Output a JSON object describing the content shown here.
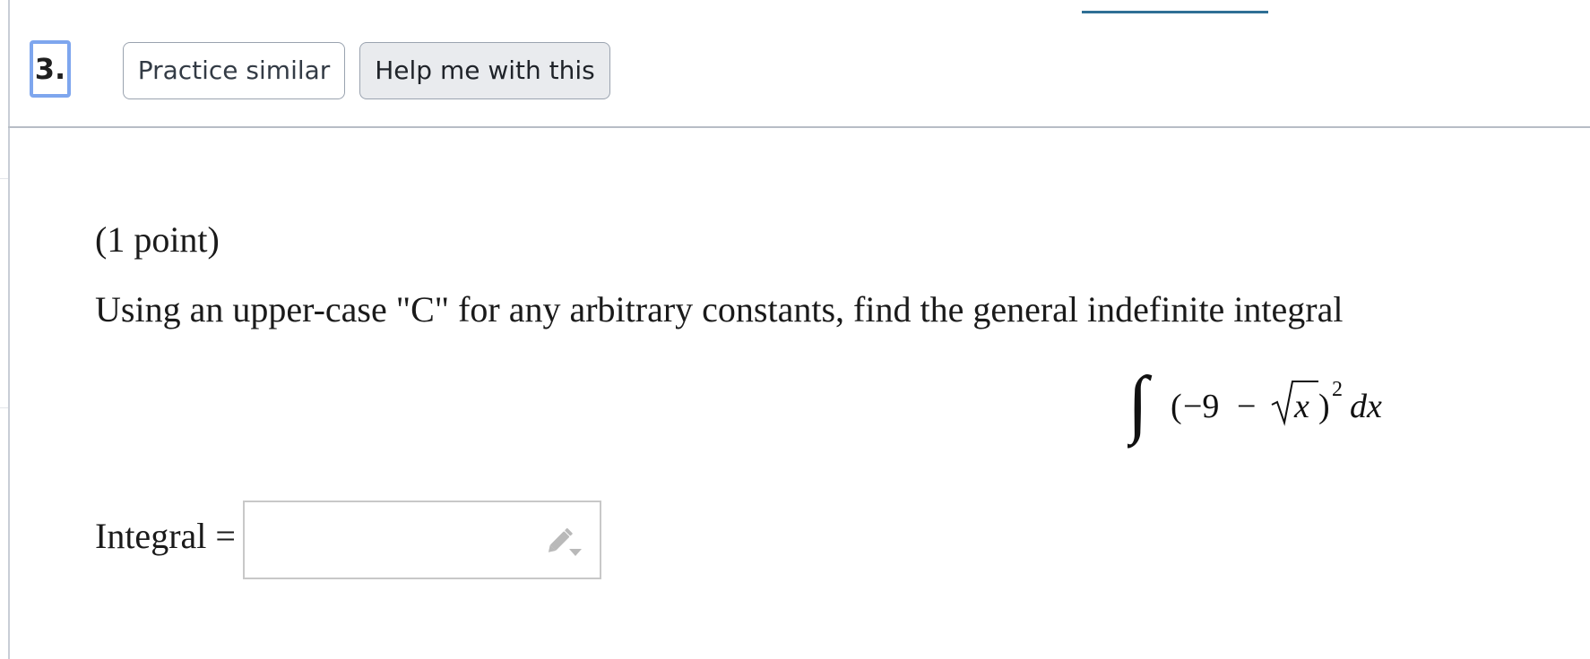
{
  "problem": {
    "number": "3.",
    "buttons": {
      "practice_similar": "Practice similar",
      "help": "Help me with this"
    },
    "points": "(1 point)",
    "instruction": "Using an upper-case \"C\" for any arbitrary constants, find the general indefinite integral",
    "integral": {
      "integral_sign": "∫",
      "open_paren": "(",
      "minus_nine": "−9",
      "minus": "−",
      "radicand": "x",
      "close_paren": ")",
      "exponent": "2",
      "differential": "dx"
    },
    "answer": {
      "label": "Integral =",
      "value": "",
      "editor_icon": "pencil-dropdown-icon"
    }
  },
  "colors": {
    "number_focus_border": "#7ea6ee",
    "top_accent": "#2f6f95",
    "divider": "#b7bdc6",
    "help_button_bg": "#e9ebee",
    "icon_gray": "#b9b9b9"
  }
}
